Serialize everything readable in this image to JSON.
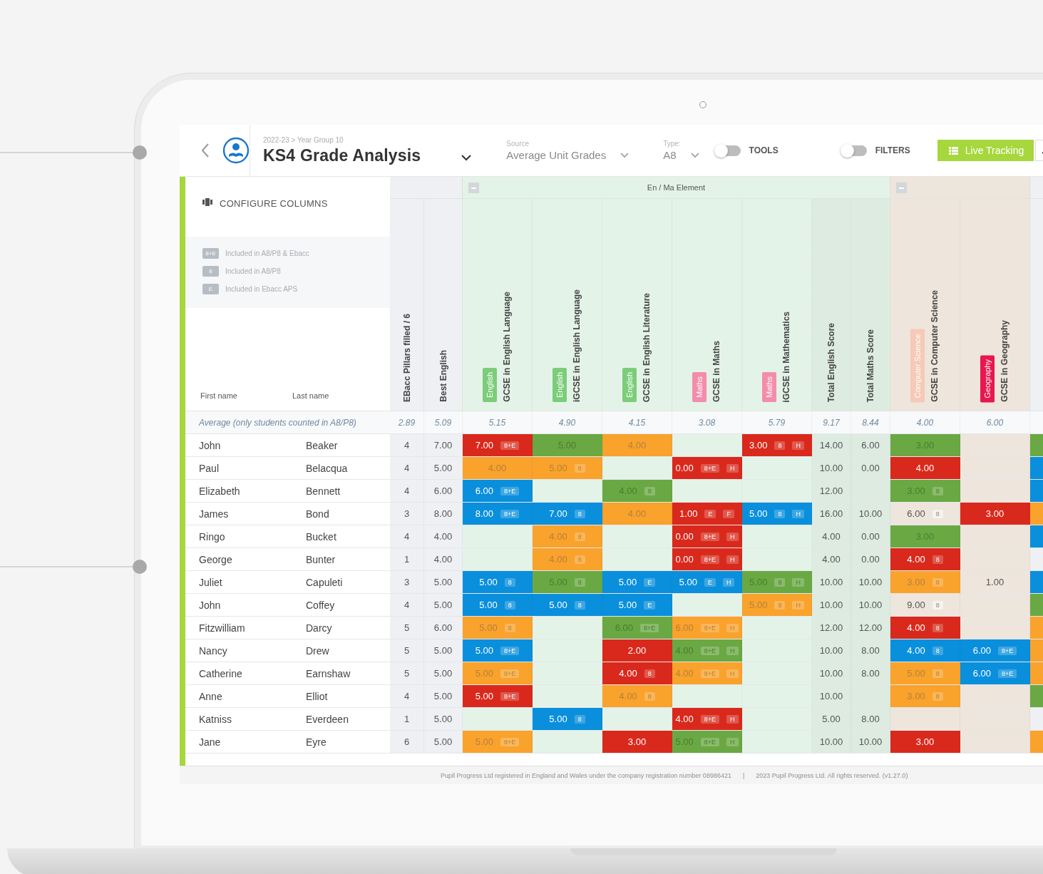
{
  "header": {
    "breadcrumb": "2022-23 > Year Group 10",
    "title": "KS4 Grade Analysis",
    "source": {
      "label": "Source",
      "value": "Average Unit Grades"
    },
    "type": {
      "label": "Type:",
      "value": "A8"
    },
    "toggles": [
      {
        "label": "TOOLS",
        "on": false
      },
      {
        "label": "FILTERS",
        "on": false
      }
    ],
    "live_tracking": "Live Tracking"
  },
  "panel": {
    "configure": "CONFIGURE COLUMNS",
    "legend": [
      {
        "badge": "8+E",
        "text": "Included in A8/P8 & Ebacc"
      },
      {
        "badge": "8",
        "text": "Included in A8/P8"
      },
      {
        "badge": "E",
        "text": "Included in Ebacc APS"
      }
    ]
  },
  "table": {
    "name_columns": [
      "First name",
      "Last name"
    ],
    "average_label": "Average (only students counted in A8/P8)",
    "groups": [
      {
        "kind": "base",
        "color": "#eef0f3",
        "columns": [
          {
            "kind": "count",
            "name": "EBacc Pillars filled / 6",
            "average": "2.89"
          },
          {
            "kind": "score",
            "name": "Best English",
            "average": "5.09"
          }
        ]
      },
      {
        "kind": "element",
        "title": "En / Ma Element",
        "color": "#e4f3e8",
        "columns": [
          {
            "kind": "subject",
            "name": "GCSE in English Language",
            "tag": {
              "label": "English",
              "color": "#7ccd79"
            },
            "average": "5.15"
          },
          {
            "kind": "subject",
            "name": "iGCSE in English Language",
            "tag": {
              "label": "English",
              "color": "#7ccd79"
            },
            "average": "4.90"
          },
          {
            "kind": "subject",
            "name": "GCSE in English Literature",
            "tag": {
              "label": "English",
              "color": "#7ccd79"
            },
            "average": "4.15"
          },
          {
            "kind": "subject",
            "name": "GCSE in Maths",
            "tag": {
              "label": "Maths",
              "color": "#f48cab"
            },
            "average": "3.08"
          },
          {
            "kind": "subject",
            "name": "iGCSE in Mathematics",
            "tag": {
              "label": "Maths",
              "color": "#f48cab"
            },
            "average": "5.79"
          },
          {
            "kind": "total",
            "name": "Total English Score",
            "average": "9.17"
          },
          {
            "kind": "total",
            "name": "Total Maths Score",
            "average": "8.44"
          }
        ]
      },
      {
        "kind": "element",
        "color": "#eee5dc",
        "columns": [
          {
            "kind": "subject",
            "name": "GCSE in Computer Science",
            "tag": {
              "label": "Computer Science",
              "color": "#f5cab6"
            },
            "average": "4.00"
          },
          {
            "kind": "subject",
            "name": "GCSE in Geography",
            "tag": {
              "label": "Geography",
              "color": "#e8174f"
            },
            "average": "6.00"
          }
        ]
      },
      {
        "kind": "cut",
        "color": "#eef0f3",
        "columns": [
          {
            "kind": "partial"
          }
        ]
      }
    ],
    "rows": [
      {
        "first": "John",
        "last": "Beaker",
        "cells": [
          {
            "value": "4"
          },
          {
            "value": "7.00"
          },
          {
            "value": "7.00",
            "color": "#d9291c",
            "badges": [
              "8+E"
            ]
          },
          {
            "value": "5.00",
            "color": "#6aa843"
          },
          {
            "value": "4.00",
            "color": "#f9a22c"
          },
          {},
          {
            "value": "3.00",
            "color": "#d9291c",
            "badges": [
              "8",
              "H"
            ]
          },
          {
            "value": "14.00"
          },
          {
            "value": "6.00"
          },
          {
            "value": "3.00",
            "color": "#6aa843"
          },
          {},
          {
            "color": "#6aa843"
          }
        ]
      },
      {
        "first": "Paul",
        "last": "Belacqua",
        "cells": [
          {
            "value": "4"
          },
          {
            "value": "5.00"
          },
          {
            "value": "4.00",
            "color": "#f9a22c"
          },
          {
            "value": "5.00",
            "color": "#f9a22c",
            "badges": [
              "8"
            ]
          },
          {},
          {
            "value": "0.00",
            "color": "#d9291c",
            "badges": [
              "8+E",
              "H"
            ]
          },
          {},
          {
            "value": "10.00"
          },
          {
            "value": "0.00"
          },
          {
            "value": "4.00",
            "color": "#d9291c"
          },
          {},
          {
            "color": "#0a8fdc"
          }
        ]
      },
      {
        "first": "Elizabeth",
        "last": "Bennett",
        "cells": [
          {
            "value": "4"
          },
          {
            "value": "6.00"
          },
          {
            "value": "6.00",
            "color": "#0a8fdc",
            "badges": [
              "8+E"
            ]
          },
          {},
          {
            "value": "4.00",
            "color": "#6aa843",
            "badges": [
              "8"
            ]
          },
          {},
          {},
          {
            "value": "12.00"
          },
          {},
          {
            "value": "3.00",
            "color": "#6aa843",
            "badges": [
              "8"
            ]
          },
          {},
          {
            "color": "#0a8fdc"
          }
        ]
      },
      {
        "first": "James",
        "last": "Bond",
        "cells": [
          {
            "value": "3"
          },
          {
            "value": "8.00"
          },
          {
            "value": "8.00",
            "color": "#0a8fdc",
            "badges": [
              "8+E"
            ]
          },
          {
            "value": "7.00",
            "color": "#0a8fdc",
            "badges": [
              "8"
            ]
          },
          {
            "value": "4.00",
            "color": "#f9a22c"
          },
          {
            "value": "1.00",
            "color": "#d9291c",
            "badges": [
              "E",
              "F"
            ]
          },
          {
            "value": "5.00",
            "color": "#0a8fdc",
            "badges": [
              "8",
              "H"
            ]
          },
          {
            "value": "16.00"
          },
          {
            "value": "10.00"
          },
          {
            "value": "6.00",
            "badges": [
              "8"
            ]
          },
          {
            "value": "3.00",
            "color": "#d9291c"
          },
          {
            "color": "#f9a22c"
          }
        ]
      },
      {
        "first": "Ringo",
        "last": "Bucket",
        "cells": [
          {
            "value": "4"
          },
          {
            "value": "4.00"
          },
          {},
          {
            "value": "4.00",
            "color": "#f9a22c",
            "badges": [
              "8"
            ]
          },
          {},
          {
            "value": "0.00",
            "color": "#d9291c",
            "badges": [
              "8+E",
              "H"
            ]
          },
          {},
          {
            "value": "4.00"
          },
          {
            "value": "0.00"
          },
          {
            "value": "3.00",
            "color": "#6aa843"
          },
          {},
          {
            "color": "#0a8fdc"
          }
        ]
      },
      {
        "first": "George",
        "last": "Bunter",
        "cells": [
          {
            "value": "1"
          },
          {
            "value": "4.00"
          },
          {},
          {
            "value": "4.00",
            "color": "#f9a22c",
            "badges": [
              "8"
            ]
          },
          {},
          {
            "value": "0.00",
            "color": "#d9291c",
            "badges": [
              "8+E",
              "H"
            ]
          },
          {},
          {
            "value": "4.00"
          },
          {
            "value": "0.00"
          },
          {
            "value": "4.00",
            "color": "#d9291c",
            "badges": [
              "8"
            ]
          },
          {},
          {}
        ]
      },
      {
        "first": "Juliet",
        "last": "Capuleti",
        "cells": [
          {
            "value": "3"
          },
          {
            "value": "5.00"
          },
          {
            "value": "5.00",
            "color": "#0a8fdc",
            "badges": [
              "8"
            ]
          },
          {
            "value": "5.00",
            "color": "#6aa843",
            "badges": [
              "8"
            ]
          },
          {
            "value": "5.00",
            "color": "#0a8fdc",
            "badges": [
              "E"
            ]
          },
          {
            "value": "5.00",
            "color": "#0a8fdc",
            "badges": [
              "E",
              "H"
            ]
          },
          {
            "value": "5.00",
            "color": "#6aa843",
            "badges": [
              "8",
              "H"
            ]
          },
          {
            "value": "10.00"
          },
          {
            "value": "10.00"
          },
          {
            "value": "3.00",
            "color": "#f9a22c",
            "badges": [
              "8"
            ]
          },
          {
            "value": "1.00"
          },
          {
            "color": "#0a8fdc"
          }
        ]
      },
      {
        "first": "John",
        "last": "Coffey",
        "cells": [
          {
            "value": "4"
          },
          {
            "value": "5.00"
          },
          {
            "value": "5.00",
            "color": "#0a8fdc",
            "badges": [
              "8"
            ]
          },
          {
            "value": "5.00",
            "color": "#0a8fdc",
            "badges": [
              "8"
            ]
          },
          {
            "value": "5.00",
            "color": "#0a8fdc",
            "badges": [
              "E"
            ]
          },
          {},
          {
            "value": "5.00",
            "color": "#f9a22c",
            "badges": [
              "8",
              "H"
            ]
          },
          {
            "value": "10.00"
          },
          {
            "value": "10.00"
          },
          {
            "value": "9.00",
            "badges": [
              "8"
            ]
          },
          {},
          {
            "color": "#6aa843"
          }
        ]
      },
      {
        "first": "Fitzwilliam",
        "last": "Darcy",
        "cells": [
          {
            "value": "5"
          },
          {
            "value": "6.00"
          },
          {
            "value": "5.00",
            "color": "#f9a22c",
            "badges": [
              "8"
            ]
          },
          {},
          {
            "value": "6.00",
            "color": "#6aa843",
            "badges": [
              "8+E"
            ]
          },
          {
            "value": "6.00",
            "color": "#f9a22c",
            "badges": [
              "8+E",
              "H"
            ]
          },
          {},
          {
            "value": "12.00"
          },
          {
            "value": "12.00"
          },
          {
            "value": "4.00",
            "color": "#d9291c",
            "badges": [
              "8"
            ]
          },
          {},
          {
            "color": "#f9a22c"
          }
        ]
      },
      {
        "first": "Nancy",
        "last": "Drew",
        "cells": [
          {
            "value": "5"
          },
          {
            "value": "5.00"
          },
          {
            "value": "5.00",
            "color": "#0a8fdc",
            "badges": [
              "8+E"
            ]
          },
          {},
          {
            "value": "2.00",
            "color": "#d9291c"
          },
          {
            "value": "4.00",
            "color": "#6aa843",
            "badges": [
              "8+E",
              "H"
            ]
          },
          {},
          {
            "value": "10.00"
          },
          {
            "value": "8.00"
          },
          {
            "value": "4.00",
            "color": "#0a8fdc",
            "badges": [
              "8"
            ]
          },
          {
            "value": "6.00",
            "color": "#0a8fdc",
            "badges": [
              "8+E"
            ]
          },
          {
            "color": "#f9a22c"
          }
        ]
      },
      {
        "first": "Catherine",
        "last": "Earnshaw",
        "cells": [
          {
            "value": "5"
          },
          {
            "value": "5.00"
          },
          {
            "value": "5.00",
            "color": "#f9a22c",
            "badges": [
              "8+E"
            ]
          },
          {},
          {
            "value": "4.00",
            "color": "#d9291c",
            "badges": [
              "8"
            ]
          },
          {
            "value": "4.00",
            "color": "#f9a22c",
            "badges": [
              "8+E",
              "H"
            ]
          },
          {},
          {
            "value": "10.00"
          },
          {
            "value": "8.00"
          },
          {
            "value": "5.00",
            "color": "#f9a22c",
            "badges": [
              "8"
            ]
          },
          {
            "value": "6.00",
            "color": "#0a8fdc",
            "badges": [
              "8+E"
            ]
          },
          {
            "color": "#f9a22c"
          }
        ]
      },
      {
        "first": "Anne",
        "last": "Elliot",
        "cells": [
          {
            "value": "4"
          },
          {
            "value": "5.00"
          },
          {
            "value": "5.00",
            "color": "#d9291c",
            "badges": [
              "8+E"
            ]
          },
          {},
          {
            "value": "4.00",
            "color": "#f9a22c",
            "badges": [
              "8"
            ]
          },
          {},
          {},
          {
            "value": "10.00"
          },
          {},
          {
            "value": "3.00",
            "color": "#f9a22c",
            "badges": [
              "8"
            ]
          },
          {},
          {
            "color": "#6aa843"
          }
        ]
      },
      {
        "first": "Katniss",
        "last": "Everdeen",
        "cells": [
          {
            "value": "1"
          },
          {
            "value": "5.00"
          },
          {},
          {
            "value": "5.00",
            "color": "#0a8fdc",
            "badges": [
              "8"
            ]
          },
          {},
          {
            "value": "4.00",
            "color": "#d9291c",
            "badges": [
              "8+E",
              "H"
            ]
          },
          {},
          {
            "value": "5.00"
          },
          {
            "value": "8.00"
          },
          {},
          {},
          {}
        ]
      },
      {
        "first": "Jane",
        "last": "Eyre",
        "cells": [
          {
            "value": "6"
          },
          {
            "value": "5.00"
          },
          {
            "value": "5.00",
            "color": "#f9a22c",
            "badges": [
              "8+E"
            ]
          },
          {},
          {
            "value": "3.00",
            "color": "#d9291c"
          },
          {
            "value": "5.00",
            "color": "#6aa843",
            "badges": [
              "8+E",
              "H"
            ]
          },
          {},
          {
            "value": "10.00"
          },
          {
            "value": "10.00"
          },
          {
            "value": "3.00",
            "color": "#d9291c"
          },
          {},
          {
            "color": "#f9a22c"
          }
        ]
      }
    ]
  },
  "footer": [
    "Pupil Progress Ltd registered in England and Wales under the company registration number 08986421",
    "|",
    "2023 Pupil Progress Ltd. All rights reserved. (v1.27.0)"
  ]
}
